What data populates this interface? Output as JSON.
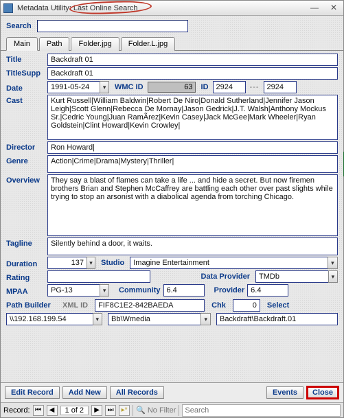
{
  "window_title": "Metadata Utility: Last Online Search",
  "search_label": "Search",
  "tabs": [
    "Main",
    "Path",
    "Folder.jpg",
    "Folder.L.jpg"
  ],
  "labels": {
    "title": "Title",
    "titleSupp": "TitleSupp",
    "date": "Date",
    "wmc_id": "WMC ID",
    "id": "ID",
    "cast": "Cast",
    "director": "Director",
    "genre": "Genre",
    "overview": "Overview",
    "tagline": "Tagline",
    "duration": "Duration",
    "studio": "Studio",
    "rating": "Rating",
    "data_provider": "Data Provider",
    "mpaa": "MPAA",
    "community": "Community",
    "provider": "Provider",
    "path_builder": "Path Builder",
    "xml_id": "XML ID",
    "chk": "Chk",
    "select": "Select"
  },
  "values": {
    "title": "Backdraft 01",
    "titleSupp": "Backdraft 01",
    "date": "1991-05-24",
    "wmc_id": "63",
    "id_a": "2924",
    "id_b": "2924",
    "cast": "Kurt Russell|William Baldwin|Robert De Niro|Donald Sutherland|Jennifer Jason Leigh|Scott Glenn|Rebecca De Mornay|Jason Gedrick|J.T. Walsh|Anthony Mockus Sr.|Cedric Young|Juan RamÃ­rez|Kevin Casey|Jack McGee|Mark Wheeler|Ryan Goldstein|Clint Howard|Kevin Crowley|",
    "director": "Ron Howard|",
    "genre": "Action|Crime|Drama|Mystery|Thriller|",
    "overview": "They say a blast of flames can take a life ... and hide a secret. But now firemen brothers Brian and Stephen McCaffrey are battling each other over past slights while trying to stop an arsonist with a diabolical agenda from torching Chicago.",
    "tagline": "Silently behind a door, it waits.",
    "duration": "137",
    "studio": "Imagine Entertainment",
    "rating": "",
    "data_provider": "TMDb",
    "mpaa": "PG-13",
    "community": "6.4",
    "provider": "6.4",
    "xml_id": "FIF8C1E2-842BAEDA",
    "chk": "0",
    "path_host": "\\\\192.168.199.54",
    "path_share": "Bb\\Wmedia",
    "path_folder": "Backdraft\\Backdraft.01"
  },
  "buttons": {
    "edit_record": "Edit Record",
    "add_new": "Add New",
    "all_records": "All Records",
    "events": "Events",
    "close": "Close"
  },
  "status": {
    "label": "Record:",
    "pos": "1 of 2",
    "no_filter": "No Filter",
    "search_ph": "Search"
  }
}
